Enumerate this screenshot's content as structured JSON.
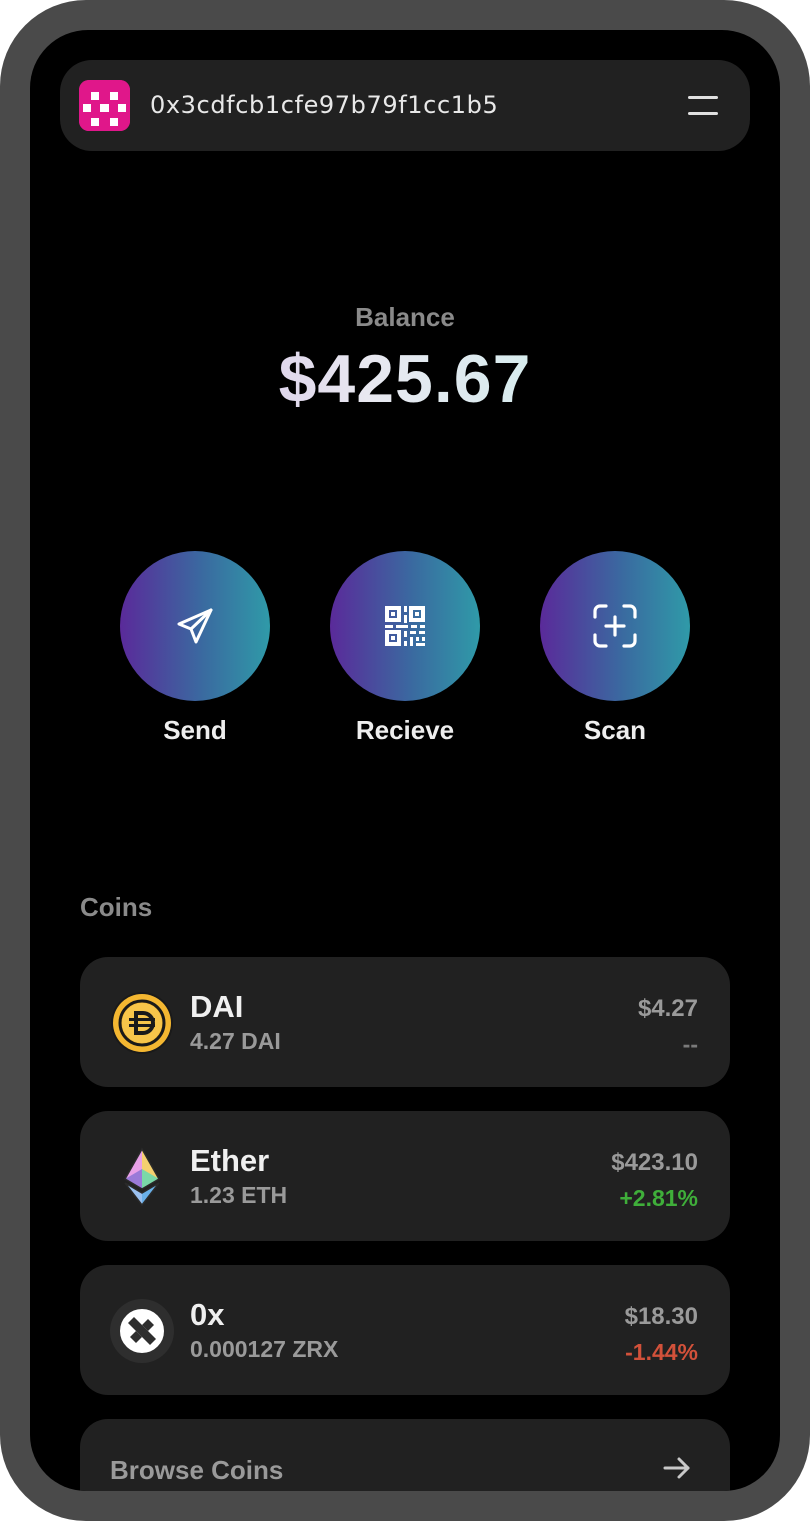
{
  "header": {
    "address": "0x3cdfcb1cfe97b79f1cc1b5",
    "avatar_icon": "pixel-avatar-icon",
    "menu_icon": "hamburger-menu-icon"
  },
  "balance": {
    "label": "Balance",
    "value": "$425.67"
  },
  "actions": [
    {
      "label": "Send",
      "icon": "paper-plane-icon"
    },
    {
      "label": "Recieve",
      "icon": "qr-code-icon"
    },
    {
      "label": "Scan",
      "icon": "scan-frame-plus-icon"
    }
  ],
  "coins": {
    "title": "Coins",
    "items": [
      {
        "name": "DAI",
        "amount": "4.27 DAI",
        "value": "$4.27",
        "change": "--",
        "icon": "dai-coin-icon"
      },
      {
        "name": "Ether",
        "amount": "1.23 ETH",
        "value": "$423.10",
        "change": "+2.81%",
        "icon": "ethereum-icon"
      },
      {
        "name": "0x",
        "amount": "0.000127 ZRX",
        "value": "$18.30",
        "change": "-1.44%",
        "icon": "zrx-icon"
      }
    ],
    "browse_label": "Browse Coins",
    "browse_icon": "arrow-right-icon"
  },
  "colors": {
    "positive": "#3fae3a",
    "negative": "#d2513a",
    "neutral": "#7a7a7a",
    "avatar": "#e0178a",
    "button_gradient_start": "#5a2a9a",
    "button_gradient_end": "#2f9aa8"
  }
}
